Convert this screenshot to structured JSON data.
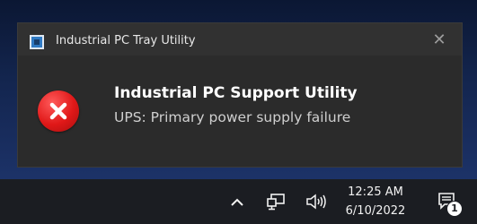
{
  "notification": {
    "app_name": "Industrial PC Tray Utility",
    "close_label": "✕",
    "title": "Industrial PC Support Utility",
    "message": "UPS: Primary power supply failure",
    "icon": "error-icon",
    "error_color": "#e01818"
  },
  "taskbar": {
    "time": "12:25 AM",
    "date": "6/10/2022",
    "notification_count": "1",
    "tray_icons": [
      "chevron-up-icon",
      "network-icon",
      "volume-icon",
      "notification-center-icon"
    ]
  }
}
